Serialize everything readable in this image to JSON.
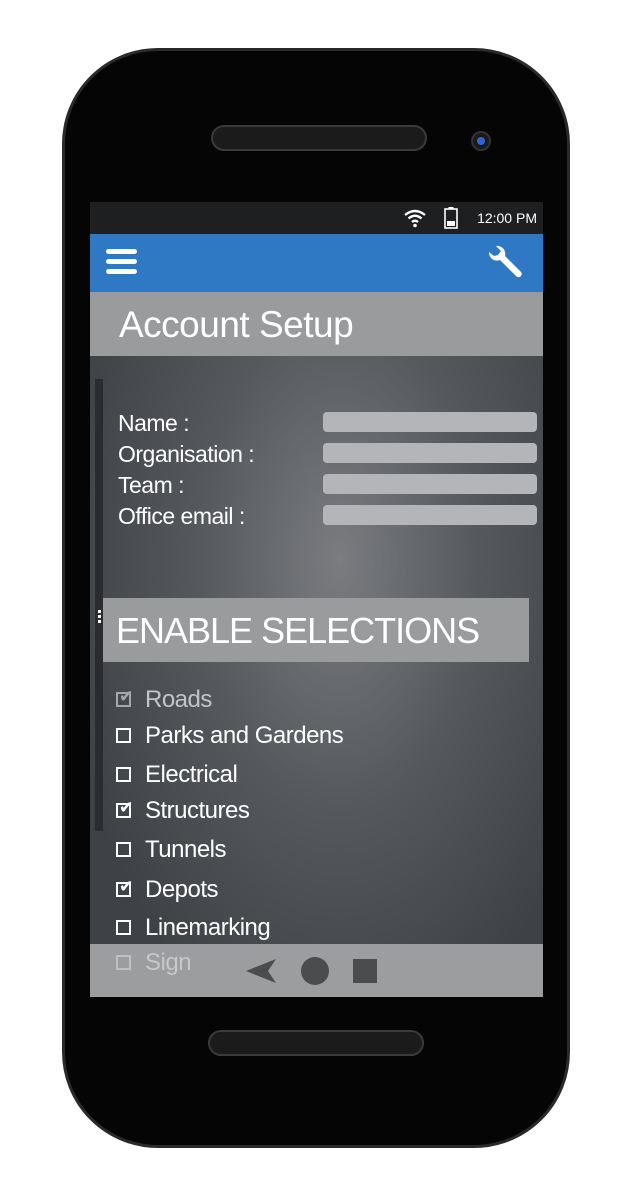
{
  "status": {
    "time": "12:00 PM",
    "icons": [
      "wifi-icon",
      "battery-icon"
    ]
  },
  "appbar": {
    "menu_icon": "menu-icon",
    "settings_icon": "wrench-icon",
    "color": "#2f79c4"
  },
  "page": {
    "title": "Account Setup"
  },
  "form": {
    "fields": [
      {
        "label": "Name :",
        "value": "",
        "placeholder": ""
      },
      {
        "label": "Organisation :",
        "value": "",
        "placeholder": ""
      },
      {
        "label": "Team :",
        "value": "",
        "placeholder": ""
      },
      {
        "label": "Office email :",
        "value": "",
        "placeholder": ""
      }
    ]
  },
  "selections": {
    "heading": "ENABLE SELECTIONS",
    "items": [
      {
        "label": "Roads",
        "checked": true,
        "disabled": true
      },
      {
        "label": "Parks and Gardens",
        "checked": false,
        "disabled": false
      },
      {
        "label": "Electrical",
        "checked": false,
        "disabled": false
      },
      {
        "label": "Structures",
        "checked": true,
        "disabled": false
      },
      {
        "label": "Tunnels",
        "checked": false,
        "disabled": false
      },
      {
        "label": "Depots",
        "checked": true,
        "disabled": false
      },
      {
        "label": "Linemarking",
        "checked": false,
        "disabled": false
      },
      {
        "label": "Sign",
        "checked": false,
        "disabled": true
      }
    ]
  },
  "navbar": {
    "icons": [
      "back-icon",
      "home-icon",
      "recents-icon"
    ]
  }
}
